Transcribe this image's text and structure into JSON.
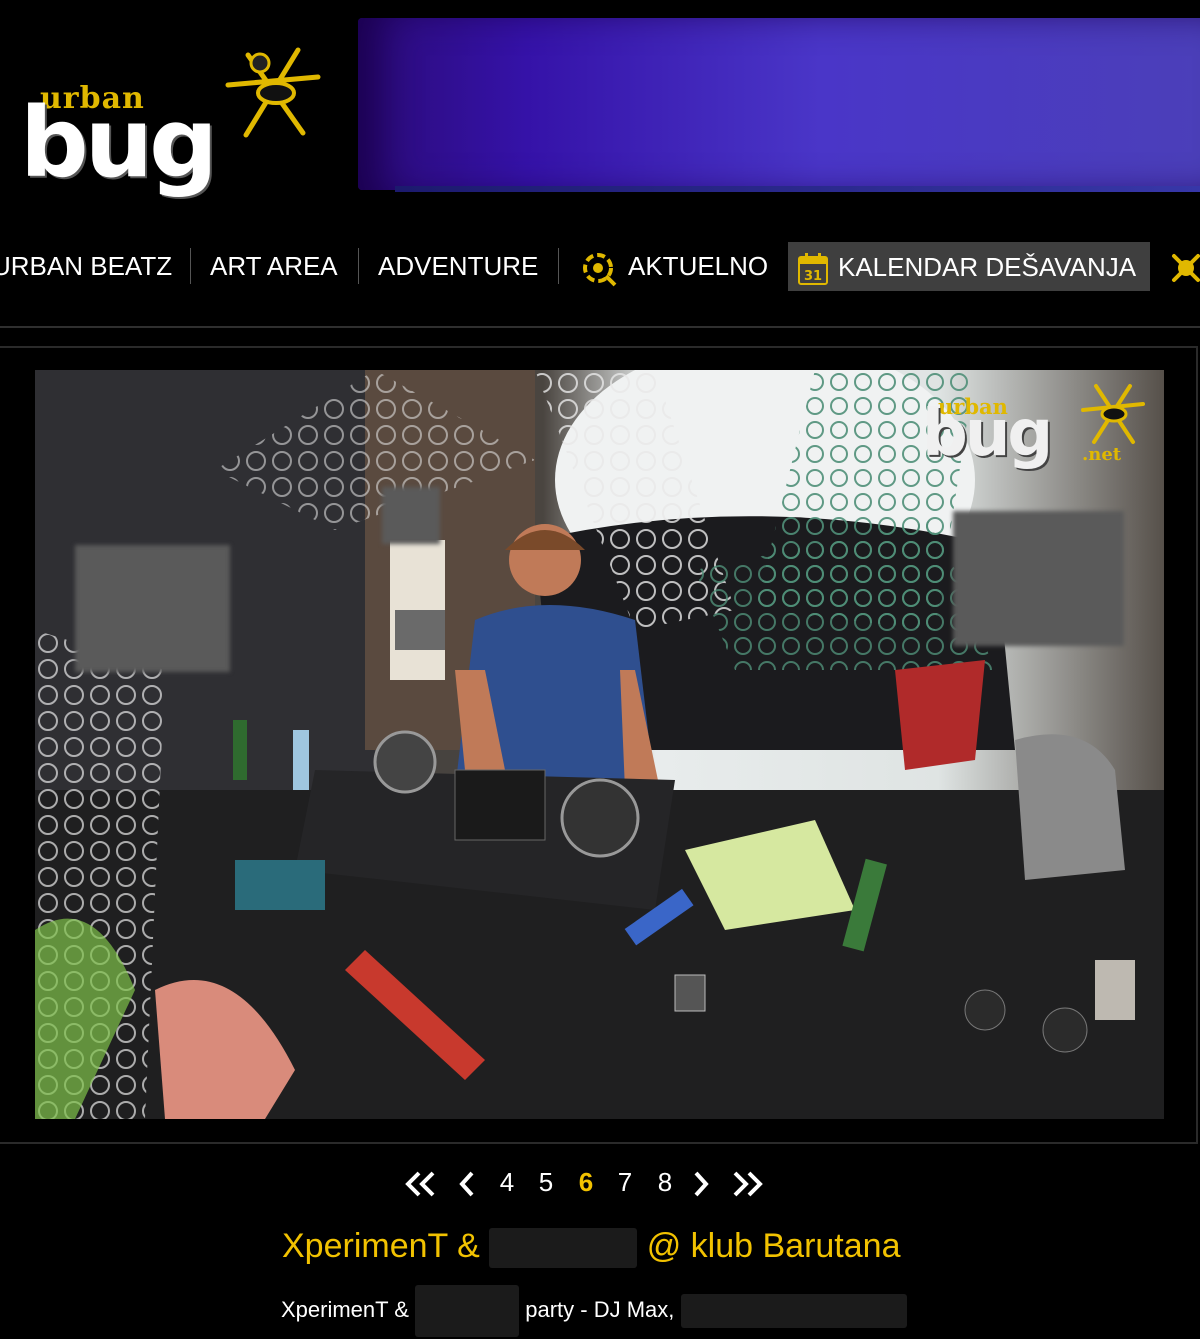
{
  "header": {
    "logo_top": "urban",
    "logo_main": "bug"
  },
  "nav": {
    "items": [
      {
        "label": "URBAN BEATZ"
      },
      {
        "label": "ART AREA"
      },
      {
        "label": "ADVENTURE"
      },
      {
        "label": "AKTUELNO",
        "icon": "bug-icon"
      },
      {
        "label": "KALENDAR DEŠAVANJA",
        "icon": "calendar-icon",
        "icon_text": "31",
        "active": true
      }
    ]
  },
  "photo": {
    "watermark_top": "urban",
    "watermark_main": "bug",
    "watermark_suffix": ".net"
  },
  "pager": {
    "first_icon": "double-chevron-left-icon",
    "prev_icon": "chevron-left-icon",
    "pages": [
      "4",
      "5",
      "6",
      "7",
      "8"
    ],
    "current": "6",
    "next_icon": "chevron-right-icon",
    "last_icon": "double-chevron-right-icon"
  },
  "gallery": {
    "title_part1": "XperimenT &",
    "title_part2": "@ klub Barutana",
    "caption_part1": "XperimenT &",
    "caption_part2": "party - DJ Max,"
  },
  "colors": {
    "accent": "#f2c200",
    "background": "#000000",
    "banner": "#3a20b0",
    "active_nav": "#3f3f3f"
  }
}
